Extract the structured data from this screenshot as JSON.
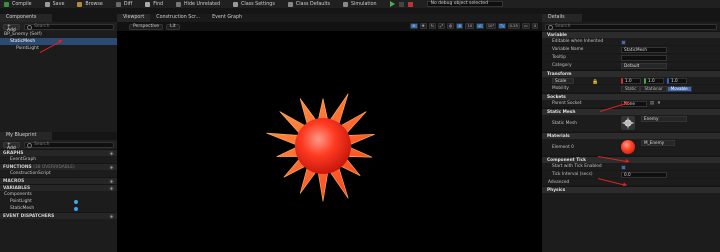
{
  "toolbar": {
    "compile": "Compile",
    "save": "Save",
    "browse": "Browse",
    "diff": "Diff",
    "find": "Find",
    "hide_unrelated": "Hide Unrelated",
    "class_settings": "Class Settings",
    "class_defaults": "Class Defaults",
    "simulation": "Simulation",
    "debug_selector": "No debug object selected"
  },
  "components": {
    "tab": "Components",
    "add_label": "+ Add",
    "search_placeholder": "Search",
    "root": "BP_Enemy (Self)",
    "items": [
      "StaticMesh",
      "PointLight"
    ]
  },
  "viewport": {
    "tabs": [
      "Viewport",
      "Construction Scr...",
      "Event Graph"
    ],
    "perspective": "Perspective",
    "lit": "Lit",
    "right_tools": [
      "10",
      "10°",
      "0.25",
      "4"
    ]
  },
  "my_blueprint": {
    "tab": "My Blueprint",
    "add_label": "+ Add",
    "search_placeholder": "Search",
    "sections": {
      "graphs": "GRAPHS",
      "event_graph": "EventGraph",
      "functions": "FUNCTIONS",
      "functions_overridable": "(38 OVERRIDABLE)",
      "construction_script": "ConstructionScript",
      "macros": "MACROS",
      "variables": "VARIABLES",
      "components": "Components",
      "point_light": "PointLight",
      "static_mesh": "StaticMesh",
      "event_dispatchers": "EVENT DISPATCHERS"
    }
  },
  "details": {
    "tab": "Details",
    "search_placeholder": "Search",
    "variable_header": "Variable",
    "editable": "Editable when Inherited",
    "variable_name_label": "Variable Name",
    "variable_name_value": "StaticMesh",
    "tooltip_label": "Tooltip",
    "category_label": "Category",
    "category_value": "Default",
    "transform_header": "Transform",
    "scale_label": "Scale",
    "scale_x": "1.0",
    "scale_y": "1.0",
    "scale_z": "1.0",
    "mobility_label": "Mobility",
    "mobility_options": [
      "Static",
      "Stationar",
      "Movable"
    ],
    "sockets_header": "Sockets",
    "parent_socket_label": "Parent Socket",
    "parent_socket_value": "None",
    "static_mesh_header": "Static Mesh",
    "static_mesh_label": "Static Mesh",
    "static_mesh_value": "Enemy",
    "materials_header": "Materials",
    "element_label": "Element 0",
    "element_value": "M_Enemy",
    "tick_header": "Component Tick",
    "start_tick_label": "Start with Tick Enabled",
    "tick_interval_label": "Tick Interval (secs)",
    "tick_interval_value": "0.0",
    "advanced": "Advanced",
    "physics_header": "Physics"
  },
  "colors": {
    "accent": "#3d6bb8",
    "selection": "#2d4a73",
    "mesh_red": "#ff3b22",
    "mesh_orange": "#ff7a2a",
    "arrow": "#e02020"
  }
}
